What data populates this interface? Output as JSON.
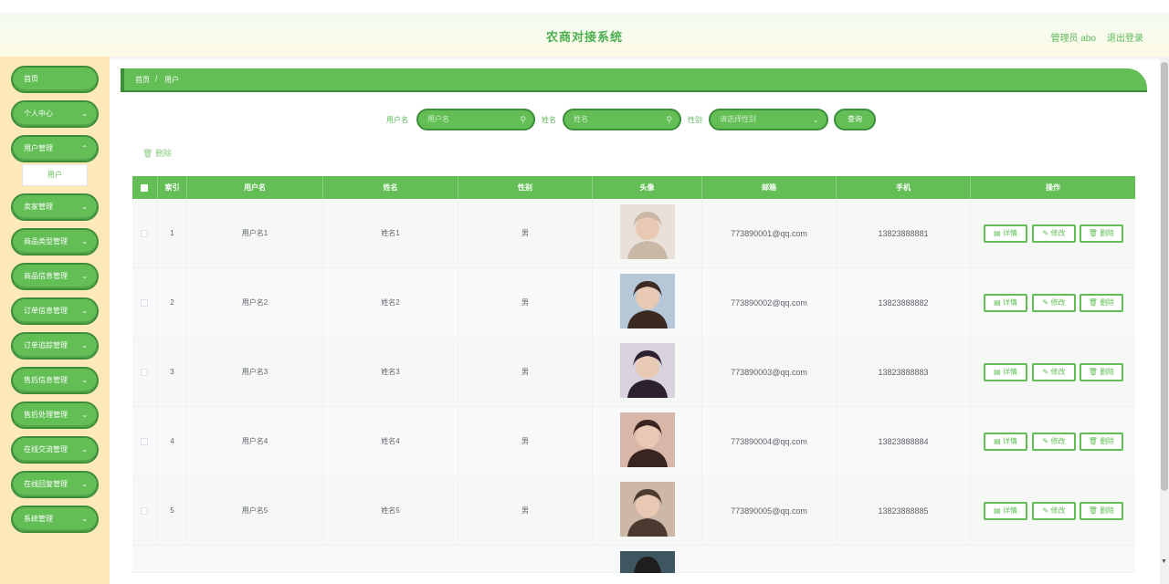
{
  "header": {
    "title": "农商对接系统",
    "user": "管理员 abo",
    "logout": "退出登录"
  },
  "sidebar": {
    "items": [
      {
        "label": "首页",
        "chevron": false
      },
      {
        "label": "个人中心",
        "chevron": true
      },
      {
        "label": "用户管理",
        "chevron": true
      },
      {
        "label": "卖家管理",
        "chevron": true
      },
      {
        "label": "商品类型管理",
        "chevron": true
      },
      {
        "label": "商品信息管理",
        "chevron": true
      },
      {
        "label": "订单信息管理",
        "chevron": true
      },
      {
        "label": "订单追踪管理",
        "chevron": true
      },
      {
        "label": "售后信息管理",
        "chevron": true
      },
      {
        "label": "售后处理管理",
        "chevron": true
      },
      {
        "label": "在线交流管理",
        "chevron": true
      },
      {
        "label": "在线回复管理",
        "chevron": true
      },
      {
        "label": "系统管理",
        "chevron": true
      }
    ],
    "submenu": "用户"
  },
  "breadcrumb": {
    "home": "首页",
    "sep": "/",
    "current": "用户"
  },
  "search": {
    "username_label": "用户名",
    "username_placeholder": "用户名",
    "name_label": "姓名",
    "name_placeholder": "姓名",
    "gender_label": "性别",
    "gender_placeholder": "请选择性别",
    "query": "查询"
  },
  "actions": {
    "delete": "删除"
  },
  "table": {
    "headers": [
      "索引",
      "用户名",
      "姓名",
      "性别",
      "头像",
      "邮箱",
      "手机",
      "操作"
    ],
    "rows": [
      {
        "index": "1",
        "username": "用户名1",
        "name": "姓名1",
        "gender": "男",
        "email": "773890001@qq.com",
        "phone": "13823888881"
      },
      {
        "index": "2",
        "username": "用户名2",
        "name": "姓名2",
        "gender": "男",
        "email": "773890002@qq.com",
        "phone": "13823888882"
      },
      {
        "index": "3",
        "username": "用户名3",
        "name": "姓名3",
        "gender": "男",
        "email": "773890003@qq.com",
        "phone": "13823888883"
      },
      {
        "index": "4",
        "username": "用户名4",
        "name": "姓名4",
        "gender": "男",
        "email": "773890004@qq.com",
        "phone": "13823888884"
      },
      {
        "index": "5",
        "username": "用户名5",
        "name": "姓名5",
        "gender": "男",
        "email": "773890005@qq.com",
        "phone": "13823888885"
      }
    ],
    "ops": {
      "detail": "详情",
      "edit": "修改",
      "delete": "删除"
    }
  },
  "colors": {
    "primary": "#62be55",
    "primary_dark": "#3c8e3a",
    "sidebar_bg": "#fde8b7"
  }
}
